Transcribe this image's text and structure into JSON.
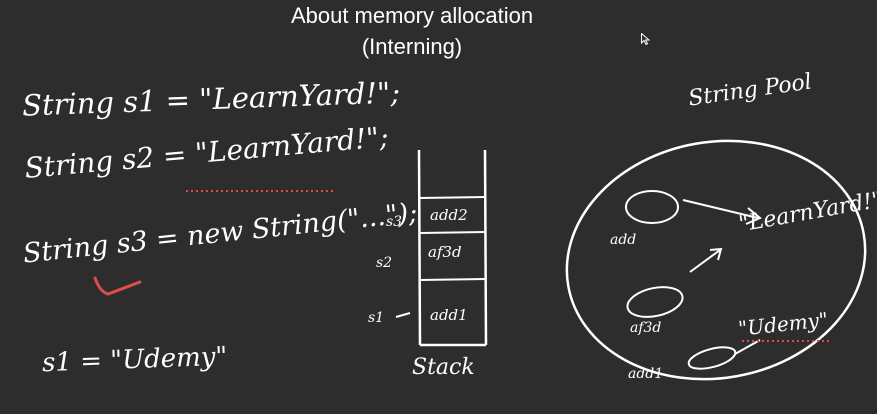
{
  "slide": {
    "title_line1": "About memory allocation",
    "title_line2": "(Interning)"
  },
  "code": {
    "line1": "String s1 = \"LearnYard!\";",
    "line2": "String s2 = \"LearnYard!\";",
    "line3": "String s3 = new String(\"...\");",
    "line4": "s1 = \"Udemy\""
  },
  "stack": {
    "label": "Stack",
    "cells": [
      "add2",
      "af3d",
      "add1"
    ],
    "row_labels": [
      "s3",
      "s2",
      "s1"
    ]
  },
  "pool": {
    "title": "String Pool",
    "entries": [
      "\"LearnYard!\"",
      "\"Udemy\""
    ],
    "addresses": [
      "add",
      "af3d",
      "add1"
    ]
  },
  "colors": {
    "background": "#2d2d2d",
    "ink": "#ffffff",
    "highlight": "#e24b4b"
  },
  "icons": [
    "mouse-cursor-icon"
  ]
}
